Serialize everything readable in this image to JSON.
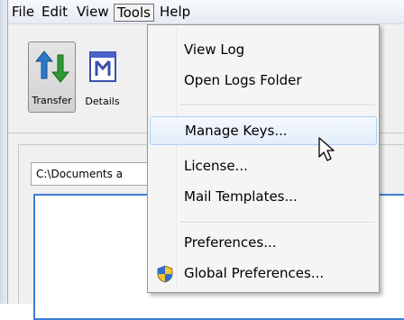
{
  "menubar": {
    "items": [
      "File",
      "Edit",
      "View",
      "Tools",
      "Help"
    ],
    "active": "Tools"
  },
  "toolbar": {
    "transfer_label": "Transfer",
    "details_label": "Details",
    "transfer_icon": "transfer-arrows-icon",
    "details_icon": "details-icon"
  },
  "panel": {
    "path_value": "C:\\Documents a"
  },
  "tools_menu": {
    "groups": [
      [
        "View Log",
        "Open Logs Folder"
      ],
      [
        "Manage Keys...",
        "License...",
        "Mail Templates..."
      ],
      [
        "Preferences...",
        "Global Preferences..."
      ]
    ],
    "hovered": "Manage Keys...",
    "global_preferences_icon": "uac-shield-icon"
  },
  "colors": {
    "hover_border": "#aecff7",
    "list_border": "#3c7fd6",
    "transfer_arrow_blue": "#2b78c9",
    "transfer_arrow_green": "#2e9a33"
  }
}
